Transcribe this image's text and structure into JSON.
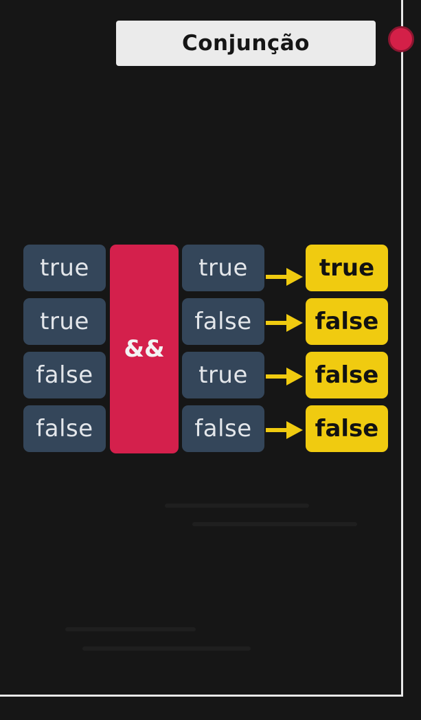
{
  "title": "Conjunção",
  "operator": "&&",
  "rows": [
    {
      "a": "true",
      "b": "true",
      "result": "true"
    },
    {
      "a": "true",
      "b": "false",
      "result": "false"
    },
    {
      "a": "false",
      "b": "true",
      "result": "false"
    },
    {
      "a": "false",
      "b": "false",
      "result": "false"
    }
  ],
  "colors": {
    "background": "#161616",
    "operand_cell": "#34465a",
    "operator_box": "#d4204c",
    "result_box": "#f0cb10",
    "arrow": "#f0cb10",
    "record_dot": "#d42048"
  },
  "icons": {
    "arrow": "arrow-right-icon",
    "record": "record-dot-icon"
  }
}
